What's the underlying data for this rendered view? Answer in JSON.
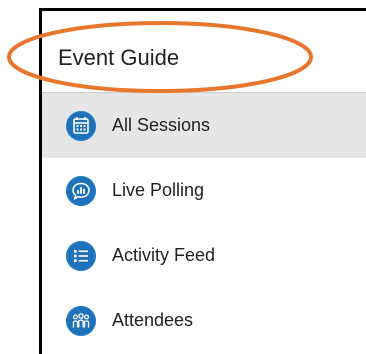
{
  "header": {
    "title": "Event Guide"
  },
  "menu": {
    "items": [
      {
        "label": "All Sessions",
        "icon": "calendar-icon",
        "active": true
      },
      {
        "label": "Live Polling",
        "icon": "poll-chat-icon",
        "active": false
      },
      {
        "label": "Activity Feed",
        "icon": "list-feed-icon",
        "active": false
      },
      {
        "label": "Attendees",
        "icon": "people-icon",
        "active": false
      }
    ]
  },
  "colors": {
    "icon_bg": "#1f71b8",
    "active_row": "#e6e6e6",
    "annotation": "#e8772e",
    "frame": "#000000"
  }
}
